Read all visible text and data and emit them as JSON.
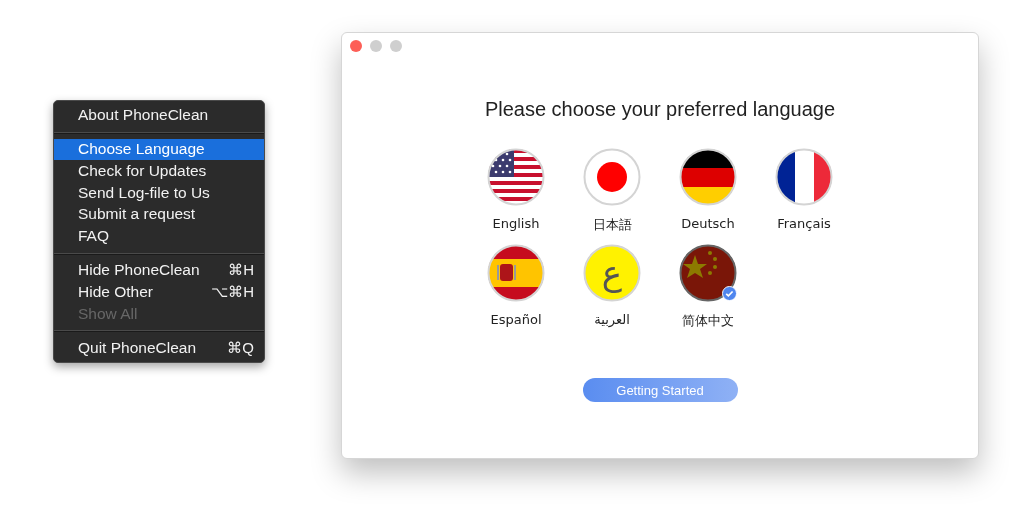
{
  "menu": {
    "groups": [
      [
        {
          "label": "About PhoneClean",
          "selected": false,
          "disabled": false
        }
      ],
      [
        {
          "label": "Choose Language",
          "selected": true,
          "disabled": false
        },
        {
          "label": "Check for Updates",
          "selected": false,
          "disabled": false
        },
        {
          "label": "Send Log-file to Us",
          "selected": false,
          "disabled": false
        },
        {
          "label": "Submit a request",
          "selected": false,
          "disabled": false
        },
        {
          "label": "FAQ",
          "selected": false,
          "disabled": false
        }
      ],
      [
        {
          "label": "Hide PhoneClean",
          "shortcut": "⌘H",
          "selected": false,
          "disabled": false
        },
        {
          "label": "Hide Other",
          "shortcut": "⌥⌘H",
          "selected": false,
          "disabled": false
        },
        {
          "label": "Show All",
          "selected": false,
          "disabled": true
        }
      ],
      [
        {
          "label": "Quit PhoneClean",
          "shortcut": "⌘Q",
          "selected": false,
          "disabled": false
        }
      ]
    ]
  },
  "window": {
    "title": "Please choose your preferred language",
    "languages": [
      {
        "label": "English",
        "kind": "us",
        "selected": false
      },
      {
        "label": "日本語",
        "kind": "jp",
        "selected": false
      },
      {
        "label": "Deutsch",
        "kind": "de",
        "selected": false
      },
      {
        "label": "Français",
        "kind": "fr",
        "selected": false
      },
      {
        "label": "Español",
        "kind": "es",
        "selected": false
      },
      {
        "label": "العربية",
        "kind": "ar",
        "glyph": "ع",
        "selected": false
      },
      {
        "label": "简体中文",
        "kind": "cn",
        "selected": true
      }
    ],
    "button": "Getting Started"
  }
}
